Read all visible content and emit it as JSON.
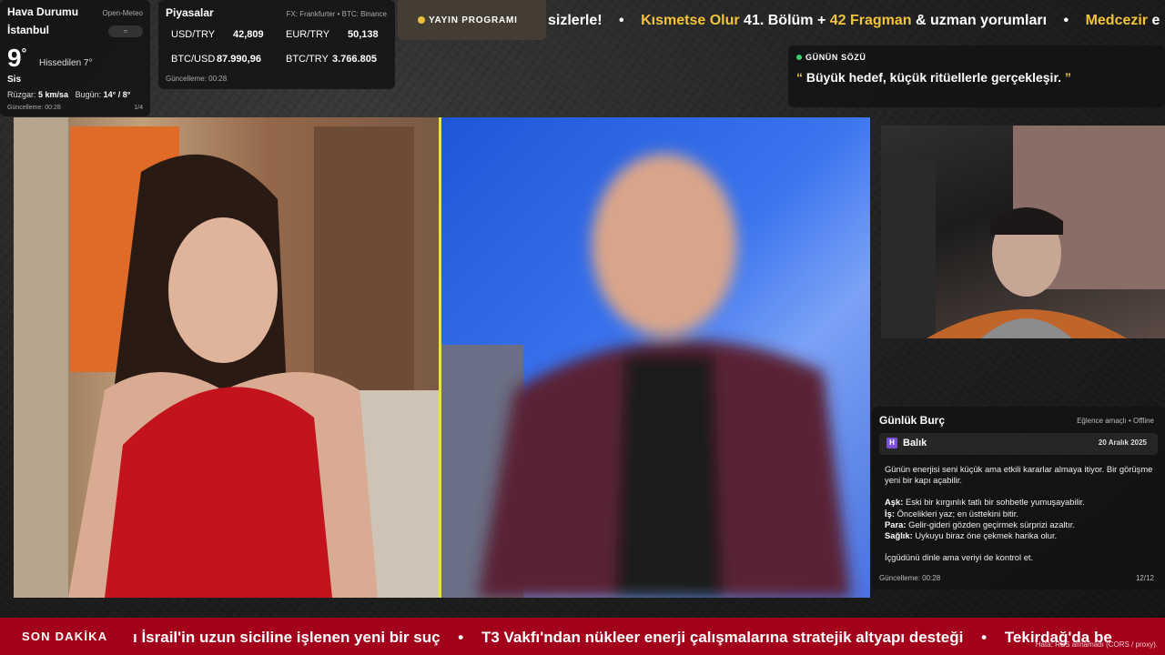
{
  "weather": {
    "title": "Hava Durumu",
    "source": "Open-Meteo",
    "city": "İstanbul",
    "badge": "≈",
    "temp": "9",
    "unit": "°",
    "feels": "Hissedilen 7°",
    "condition": "Sis",
    "wind_label": "Rüzgar:",
    "wind_value": "5 km/sa",
    "today_label": "Bugün:",
    "today_value": "14° / 8°",
    "updated": "Güncelleme: 00:28",
    "page": "1/4"
  },
  "markets": {
    "title": "Piyasalar",
    "source": "FX: Frankfurter • BTC: Binance",
    "rows": [
      {
        "l1": "USD/TRY",
        "v1": "42,809",
        "l2": "EUR/TRY",
        "v2": "50,138"
      },
      {
        "l1": "BTC/USD",
        "v1": "87.990,96",
        "l2": "BTC/TRY",
        "v2": "3.766.805"
      }
    ],
    "updated": "Güncelleme: 00:28"
  },
  "schedule": {
    "label": "YAYIN PROGRAMI"
  },
  "top_ticker": {
    "parts": [
      "sizlerle!",
      "•",
      "Kısmetse Olur",
      "41. Bölüm +",
      "42 Fragman",
      "& uzman yorumları",
      "•",
      "Medcezir",
      "e"
    ]
  },
  "quote": {
    "heading": "GÜNÜN SÖZÜ",
    "open": "“",
    "text": "Büyük hedef, küçük ritüellerle gerçekleşir.",
    "close": "”"
  },
  "horoscope": {
    "title": "Günlük Burç",
    "mode": "Eğlence amaçlı • Offline",
    "sign_icon": "H",
    "sign": "Balık",
    "date": "20 Aralık 2025",
    "intro": "Günün enerjisi seni küçük ama etkili kararlar almaya itiyor. Bir görüşme yeni bir kapı açabilir.",
    "items": [
      {
        "k": "Aşk:",
        "v": "Eski bir kırgınlık tatlı bir sohbetle yumuşayabilir."
      },
      {
        "k": "İş:",
        "v": "Öncelikleri yaz; en üsttekini bitir."
      },
      {
        "k": "Para:",
        "v": "Gelir-gideri gözden geçirmek sürprizi azaltır."
      },
      {
        "k": "Sağlık:",
        "v": "Uykuyu biraz öne çekmek harika olur."
      }
    ],
    "outro": "İçgüdünü dinle ama veriyi de kontrol et.",
    "updated": "Güncelleme: 00:28",
    "page": "12/12"
  },
  "breaking": {
    "tag": "SON DAKİKA",
    "items": [
      "ı İsrail'in uzun siciline işlenen yeni bir suç",
      "T3 Vakfı'ndan nükleer enerji çalışmalarına stratejik altyapı desteği",
      "Tekirdağ'da be"
    ],
    "sep": "•",
    "error": "Hata: RSS alınamadı (CORS / proxy)."
  },
  "colors": {
    "accent": "#f3c33b",
    "breaking_bg": "#a3001b",
    "live_dot": "#3ad36a"
  }
}
